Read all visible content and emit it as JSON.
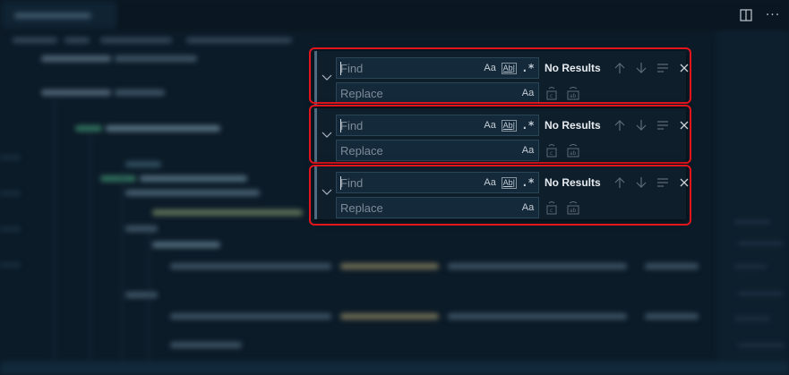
{
  "editor_actions": {
    "split_icon": "split-editor-icon",
    "more_icon": "more-actions-icon",
    "more_label": "···"
  },
  "find_widgets": [
    {
      "find_placeholder": "Find",
      "replace_placeholder": "Replace",
      "match_case_label": "Aa",
      "whole_word_label": "Ab|",
      "regex_label": ".*",
      "preserve_case_label": "Aa",
      "results_text": "No Results"
    },
    {
      "find_placeholder": "Find",
      "replace_placeholder": "Replace",
      "match_case_label": "Aa",
      "whole_word_label": "Ab|",
      "regex_label": ".*",
      "preserve_case_label": "Aa",
      "results_text": "No Results"
    },
    {
      "find_placeholder": "Find",
      "replace_placeholder": "Replace",
      "match_case_label": "Aa",
      "whole_word_label": "Ab|",
      "regex_label": ".*",
      "preserve_case_label": "Aa",
      "results_text": "No Results"
    }
  ],
  "colors": {
    "highlight_outline": "#e3141c",
    "widget_background": "#0e1e2b",
    "editor_background": "#0c1b28"
  }
}
